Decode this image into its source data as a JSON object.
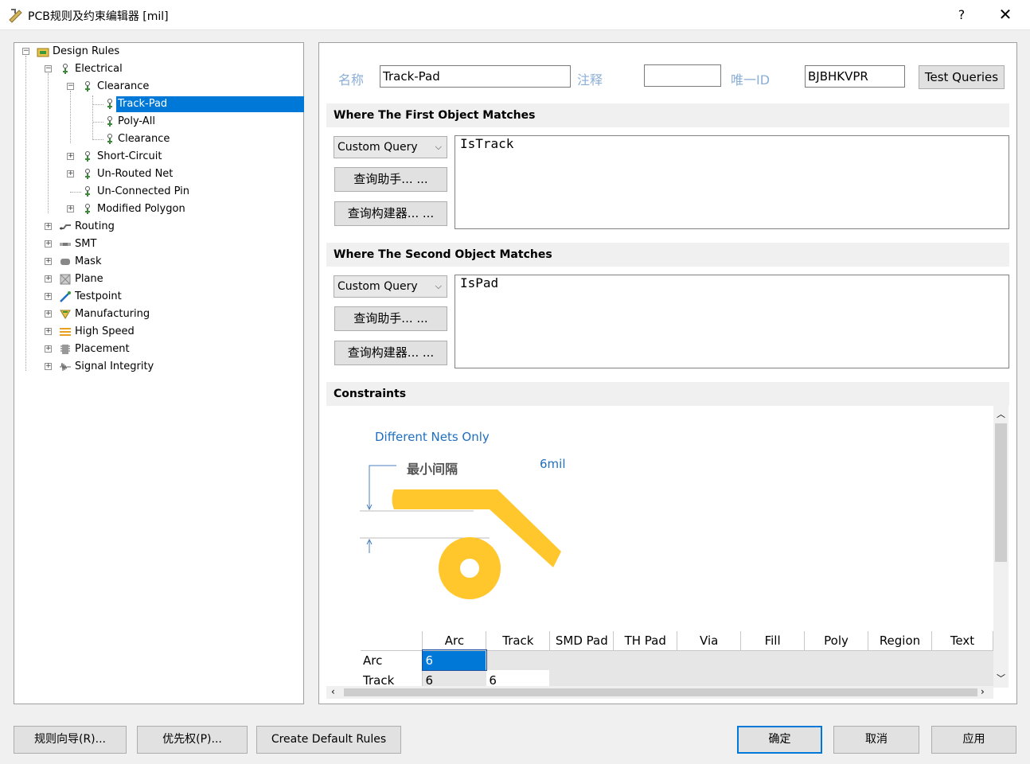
{
  "window": {
    "title": "PCB规则及约束编辑器 [mil]",
    "help": "?",
    "close": "✕"
  },
  "tree": {
    "root": "Design Rules",
    "electrical": "Electrical",
    "clearance": "Clearance",
    "clearance_children": [
      "Track-Pad",
      "Poly-All",
      "Clearance"
    ],
    "electrical_children": [
      "Short-Circuit",
      "Un-Routed Net",
      "Un-Connected Pin",
      "Modified Polygon"
    ],
    "categories": [
      "Routing",
      "SMT",
      "Mask",
      "Plane",
      "Testpoint",
      "Manufacturing",
      "High Speed",
      "Placement",
      "Signal Integrity"
    ]
  },
  "rule": {
    "name_label": "名称",
    "name_value": "Track-Pad",
    "comment_label": "注释",
    "comment_value": "",
    "uid_label": "唯一ID",
    "uid_value": "BJBHKVPR",
    "test_queries": "Test Queries"
  },
  "first_match": {
    "header": "Where The First Object Matches",
    "combo": "Custom Query",
    "helper_btn": "查询助手... ...",
    "builder_btn": "查询构建器... ...",
    "query": "IsTrack"
  },
  "second_match": {
    "header": "Where The Second Object Matches",
    "combo": "Custom Query",
    "helper_btn": "查询助手... ...",
    "builder_btn": "查询构建器... ...",
    "query": "IsPad"
  },
  "constraints": {
    "header": "Constraints",
    "net_scope": "Different Nets Only",
    "min_clearance_label": "最小间隔",
    "min_clearance_value": "6mil",
    "table": {
      "columns": [
        "Arc",
        "Track",
        "SMD Pad",
        "TH Pad",
        "Via",
        "Fill",
        "Poly",
        "Region",
        "Text"
      ],
      "rows": [
        {
          "name": "Arc",
          "values": [
            "6"
          ]
        },
        {
          "name": "Track",
          "values": [
            "6",
            "6"
          ]
        }
      ]
    }
  },
  "footer": {
    "wizard": "规则向导(R)...",
    "priority": "优先权(P)...",
    "create_default": "Create Default Rules",
    "ok": "确定",
    "cancel": "取消",
    "apply": "应用"
  },
  "colors": {
    "accent": "#0078d7",
    "label_blue": "#8aaed6",
    "diagram_gold": "#ffc72c"
  }
}
